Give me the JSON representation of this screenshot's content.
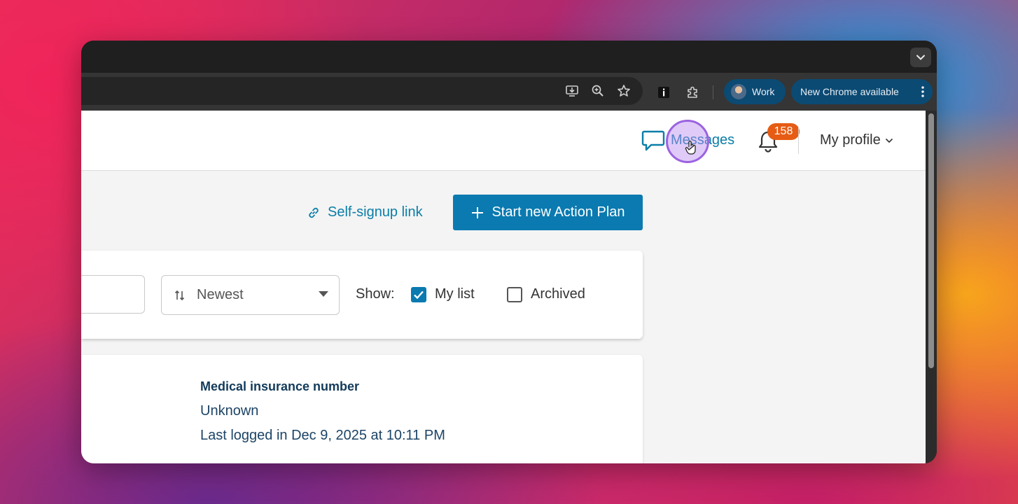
{
  "browser": {
    "profile_chip_label": "Work",
    "update_chip_label": "New Chrome available",
    "toolbar_icons": [
      "install-app-icon",
      "zoom-icon",
      "bookmark-star-icon",
      "extension-info-icon",
      "extensions-puzzle-icon"
    ]
  },
  "header": {
    "messages_label": "Messages",
    "notification_count": "158",
    "profile_label": "My profile"
  },
  "actions": {
    "self_signup_label": "Self-signup link",
    "start_plan_label": "Start new Action Plan"
  },
  "filters": {
    "sort_value": "Newest",
    "show_label": "Show:",
    "my_list_label": "My list",
    "my_list_checked": true,
    "archived_label": "Archived",
    "archived_checked": false
  },
  "record": {
    "field_title": "Medical insurance number",
    "field_value": "Unknown",
    "last_logged": "Last logged in Dec 9, 2025 at 10:11 PM"
  },
  "colors": {
    "accent": "#0a7ab0",
    "link": "#0a7ea8",
    "badge": "#e65c14",
    "chip": "#0b4a73"
  }
}
